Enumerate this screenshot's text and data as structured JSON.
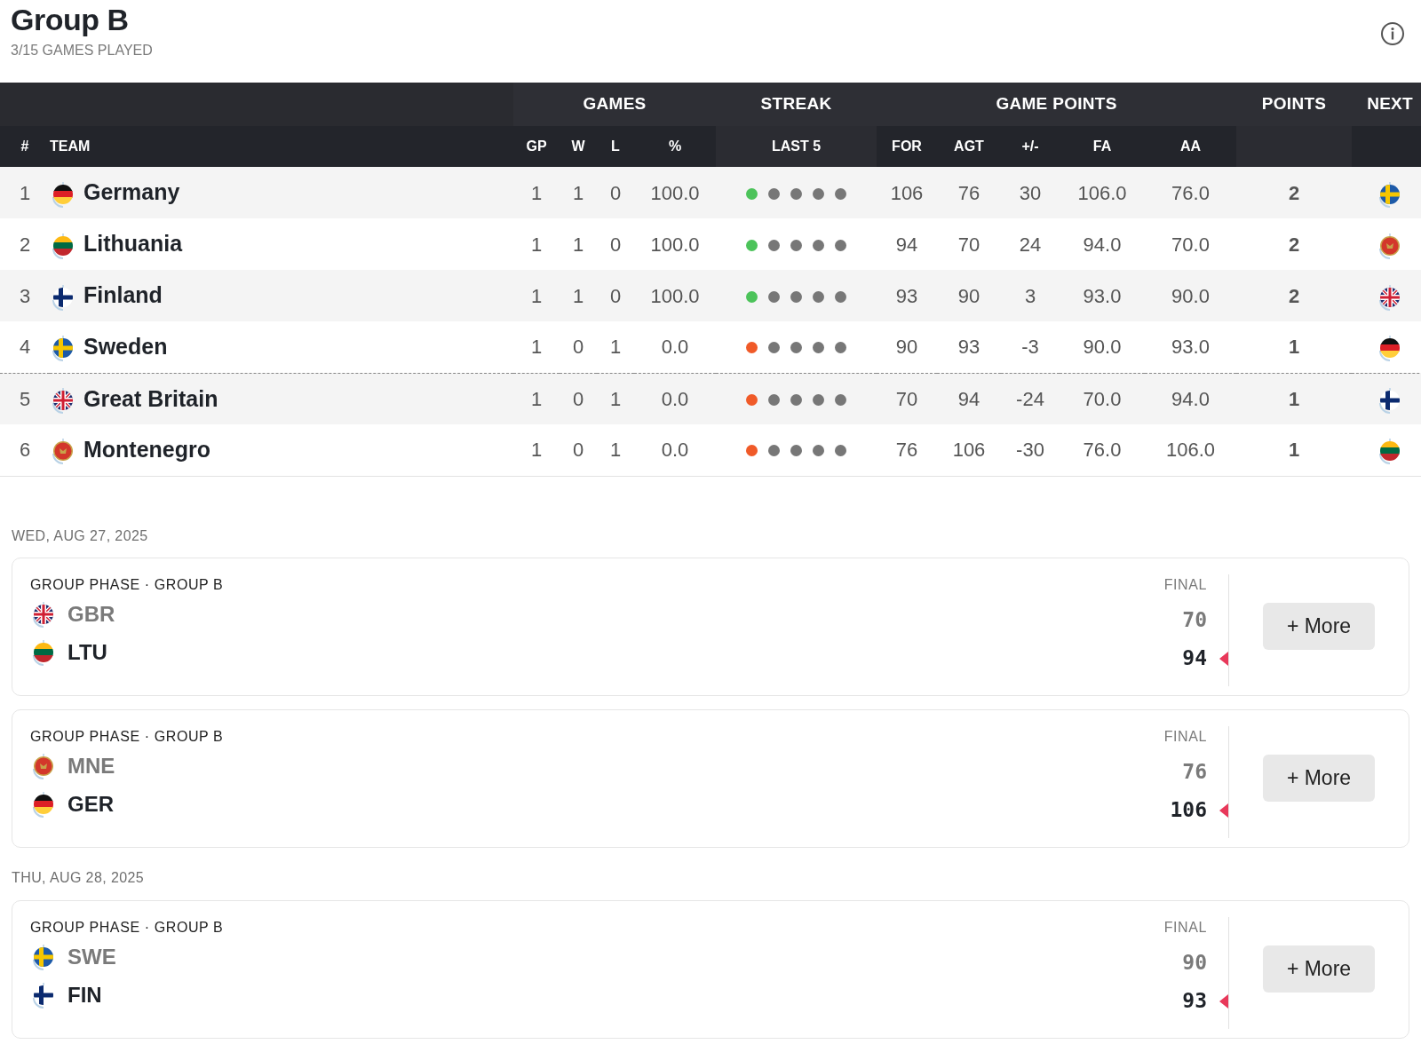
{
  "header": {
    "title": "Group B",
    "subtitle": "3/15 GAMES PLAYED"
  },
  "table": {
    "groups": [
      {
        "label": "GAMES"
      },
      {
        "label": "STREAK"
      },
      {
        "label": "GAME POINTS"
      },
      {
        "label": "POINTS"
      },
      {
        "label": "NEXT"
      }
    ],
    "columns": [
      "#",
      "TEAM",
      "GP",
      "W",
      "L",
      "%",
      "LAST 5",
      "FOR",
      "AGT",
      "+/-",
      "FA",
      "AA"
    ],
    "rows": [
      {
        "rank": "1",
        "flag": {
          "kind": "de"
        },
        "team": "Germany",
        "gp": "1",
        "w": "1",
        "l": "0",
        "pct": "100.0",
        "streak": [
          {
            "color": "#4cc35a"
          },
          {
            "color": "#777777"
          },
          {
            "color": "#777777"
          },
          {
            "color": "#777777"
          },
          {
            "color": "#777777"
          }
        ],
        "for": "106",
        "agt": "76",
        "diff": "30",
        "fa": "106.0",
        "aa": "76.0",
        "points": "2",
        "next_flag": {
          "kind": "se"
        },
        "cutoff_below": false
      },
      {
        "rank": "2",
        "flag": {
          "kind": "lt"
        },
        "team": "Lithuania",
        "gp": "1",
        "w": "1",
        "l": "0",
        "pct": "100.0",
        "streak": [
          {
            "color": "#4cc35a"
          },
          {
            "color": "#777777"
          },
          {
            "color": "#777777"
          },
          {
            "color": "#777777"
          },
          {
            "color": "#777777"
          }
        ],
        "for": "94",
        "agt": "70",
        "diff": "24",
        "fa": "94.0",
        "aa": "70.0",
        "points": "2",
        "next_flag": {
          "kind": "me"
        },
        "cutoff_below": false
      },
      {
        "rank": "3",
        "flag": {
          "kind": "fi"
        },
        "team": "Finland",
        "gp": "1",
        "w": "1",
        "l": "0",
        "pct": "100.0",
        "streak": [
          {
            "color": "#4cc35a"
          },
          {
            "color": "#777777"
          },
          {
            "color": "#777777"
          },
          {
            "color": "#777777"
          },
          {
            "color": "#777777"
          }
        ],
        "for": "93",
        "agt": "90",
        "diff": "3",
        "fa": "93.0",
        "aa": "90.0",
        "points": "2",
        "next_flag": {
          "kind": "gb"
        },
        "cutoff_below": false
      },
      {
        "rank": "4",
        "flag": {
          "kind": "se"
        },
        "team": "Sweden",
        "gp": "1",
        "w": "0",
        "l": "1",
        "pct": "0.0",
        "streak": [
          {
            "color": "#f05a28"
          },
          {
            "color": "#777777"
          },
          {
            "color": "#777777"
          },
          {
            "color": "#777777"
          },
          {
            "color": "#777777"
          }
        ],
        "for": "90",
        "agt": "93",
        "diff": "-3",
        "fa": "90.0",
        "aa": "93.0",
        "points": "1",
        "next_flag": {
          "kind": "de"
        },
        "cutoff_below": true
      },
      {
        "rank": "5",
        "flag": {
          "kind": "gb"
        },
        "team": "Great Britain",
        "gp": "1",
        "w": "0",
        "l": "1",
        "pct": "0.0",
        "streak": [
          {
            "color": "#f05a28"
          },
          {
            "color": "#777777"
          },
          {
            "color": "#777777"
          },
          {
            "color": "#777777"
          },
          {
            "color": "#777777"
          }
        ],
        "for": "70",
        "agt": "94",
        "diff": "-24",
        "fa": "70.0",
        "aa": "94.0",
        "points": "1",
        "next_flag": {
          "kind": "fi"
        },
        "cutoff_below": false
      },
      {
        "rank": "6",
        "flag": {
          "kind": "me"
        },
        "team": "Montenegro",
        "gp": "1",
        "w": "0",
        "l": "1",
        "pct": "0.0",
        "streak": [
          {
            "color": "#f05a28"
          },
          {
            "color": "#777777"
          },
          {
            "color": "#777777"
          },
          {
            "color": "#777777"
          },
          {
            "color": "#777777"
          }
        ],
        "for": "76",
        "agt": "106",
        "diff": "-30",
        "fa": "76.0",
        "aa": "106.0",
        "points": "1",
        "next_flag": {
          "kind": "lt"
        },
        "cutoff_below": false
      }
    ]
  },
  "days": [
    {
      "date": "WED, AUG 27, 2025",
      "games": [
        {
          "phase": "GROUP PHASE · GROUP B",
          "status": "FINAL",
          "button": "+ More",
          "teams": [
            {
              "flag": {
                "kind": "gb"
              },
              "code": "GBR",
              "score": "70",
              "winner": false
            },
            {
              "flag": {
                "kind": "lt"
              },
              "code": "LTU",
              "score": "94",
              "winner": true
            }
          ]
        },
        {
          "phase": "GROUP PHASE · GROUP B",
          "status": "FINAL",
          "button": "+ More",
          "teams": [
            {
              "flag": {
                "kind": "me"
              },
              "code": "MNE",
              "score": "76",
              "winner": false
            },
            {
              "flag": {
                "kind": "de"
              },
              "code": "GER",
              "score": "106",
              "winner": true
            }
          ]
        }
      ]
    },
    {
      "date": "THU, AUG 28, 2025",
      "games": [
        {
          "phase": "GROUP PHASE · GROUP B",
          "status": "FINAL",
          "button": "+ More",
          "teams": [
            {
              "flag": {
                "kind": "se"
              },
              "code": "SWE",
              "score": "90",
              "winner": false
            },
            {
              "flag": {
                "kind": "fi"
              },
              "code": "FIN",
              "score": "93",
              "winner": true
            }
          ]
        }
      ]
    }
  ]
}
